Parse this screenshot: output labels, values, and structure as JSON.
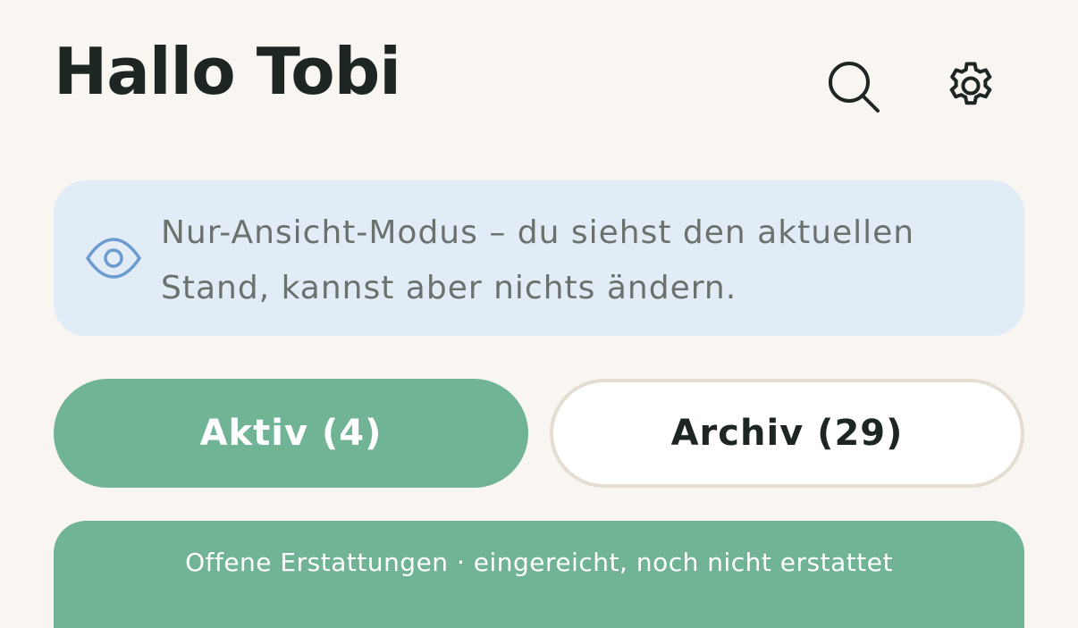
{
  "header": {
    "greeting": "Hallo Tobi"
  },
  "toolbar": {
    "search_icon": "search-icon",
    "settings_icon": "gear-icon"
  },
  "info_banner": {
    "icon": "eye-icon",
    "text": "Nur-Ansicht-Modus – du siehst den aktuellen Stand, kannst aber nichts ändern."
  },
  "tabs": [
    {
      "label": "Aktiv (4)",
      "selected": true
    },
    {
      "label": "Archiv (29)",
      "selected": false
    }
  ],
  "section": {
    "caption": "Offene Erstattungen · eingereicht, noch nicht erstattet"
  },
  "colors": {
    "background": "#f9f6f2",
    "accent_green": "#70b495",
    "info_blue": "#e2ecf6",
    "icon_blue": "#6b9bcf",
    "text_dark": "#1d2622",
    "text_muted": "#6b716d"
  }
}
